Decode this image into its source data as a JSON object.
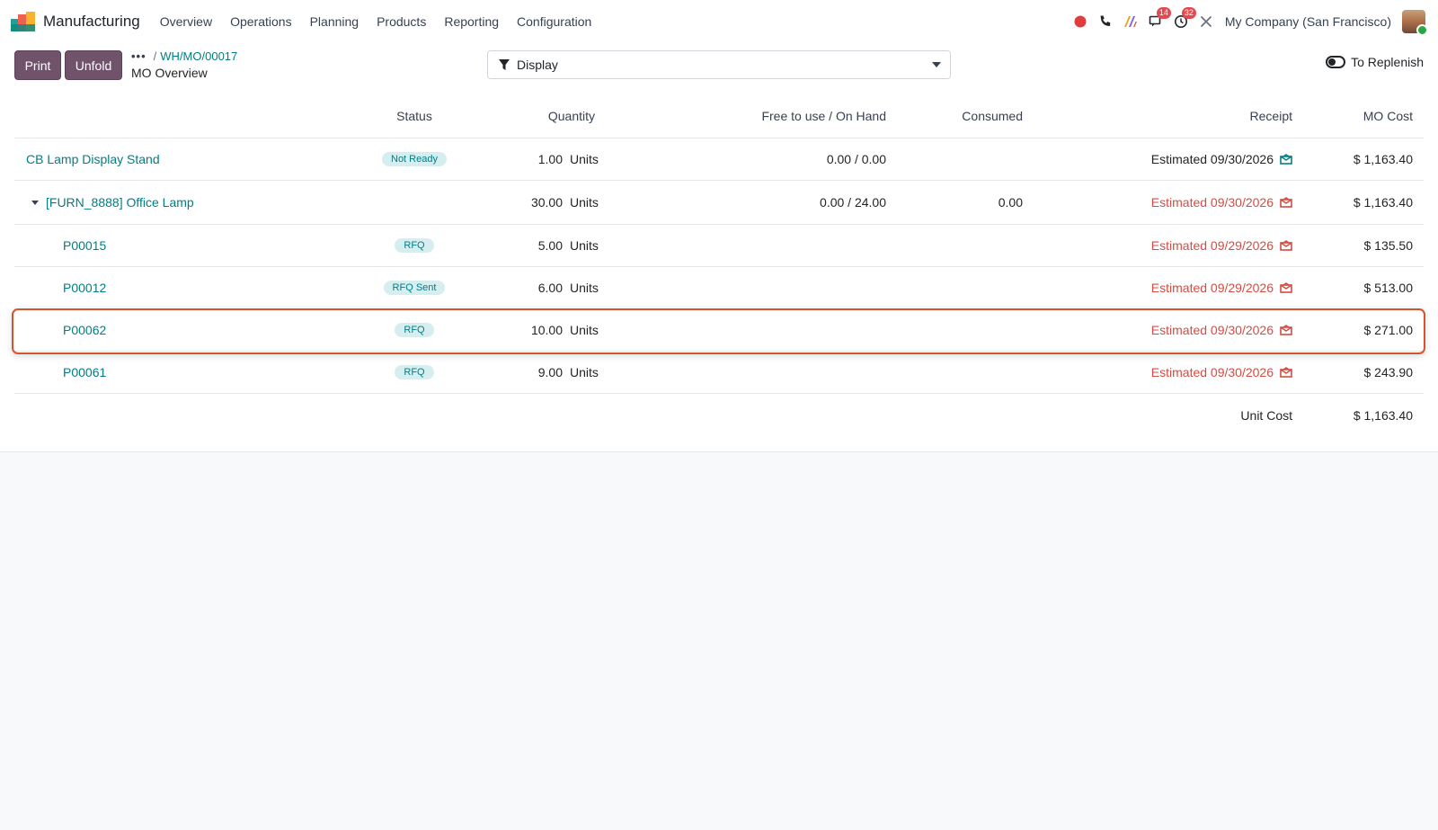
{
  "navbar": {
    "app_name": "Manufacturing",
    "menu": [
      "Overview",
      "Operations",
      "Planning",
      "Products",
      "Reporting",
      "Configuration"
    ],
    "messages_count": "14",
    "activities_count": "32",
    "company": "My Company (San Francisco)"
  },
  "control": {
    "print_label": "Print",
    "unfold_label": "Unfold",
    "breadcrumb_dots": "•••",
    "breadcrumb_sep": "/",
    "breadcrumb_link": "WH/MO/00017",
    "breadcrumb_current": "MO Overview",
    "display_label": "Display",
    "replenish_label": "To Replenish"
  },
  "table": {
    "headers": {
      "status": "Status",
      "quantity": "Quantity",
      "free_on_hand": "Free to use / On Hand",
      "consumed": "Consumed",
      "receipt": "Receipt",
      "mo_cost": "MO Cost"
    },
    "rows": [
      {
        "name": "CB Lamp Display Stand",
        "status": "Not Ready",
        "qty": "1.00",
        "uom": "Units",
        "free": "0.00 / 0.00",
        "consumed": "",
        "receipt": "Estimated 09/30/2026",
        "cost": "$ 1,163.40"
      },
      {
        "name": "[FURN_8888] Office Lamp",
        "status": "",
        "qty": "30.00",
        "uom": "Units",
        "free": "0.00 / 24.00",
        "consumed": "0.00",
        "receipt": "Estimated 09/30/2026",
        "cost": "$ 1,163.40"
      },
      {
        "name": "P00015",
        "status": "RFQ",
        "qty": "5.00",
        "uom": "Units",
        "free": "",
        "consumed": "",
        "receipt": "Estimated 09/29/2026",
        "cost": "$ 135.50"
      },
      {
        "name": "P00012",
        "status": "RFQ Sent",
        "qty": "6.00",
        "uom": "Units",
        "free": "",
        "consumed": "",
        "receipt": "Estimated 09/29/2026",
        "cost": "$ 513.00"
      },
      {
        "name": "P00062",
        "status": "RFQ",
        "qty": "10.00",
        "uom": "Units",
        "free": "",
        "consumed": "",
        "receipt": "Estimated 09/30/2026",
        "cost": "$ 271.00"
      },
      {
        "name": "P00061",
        "status": "RFQ",
        "qty": "9.00",
        "uom": "Units",
        "free": "",
        "consumed": "",
        "receipt": "Estimated 09/30/2026",
        "cost": "$ 243.90"
      }
    ],
    "footer": {
      "label": "Unit Cost",
      "value": "$ 1,163.40"
    }
  },
  "colors": {
    "primary": "#71526b",
    "link": "#017e84",
    "late": "#d44c42",
    "highlight": "#d4552d"
  }
}
